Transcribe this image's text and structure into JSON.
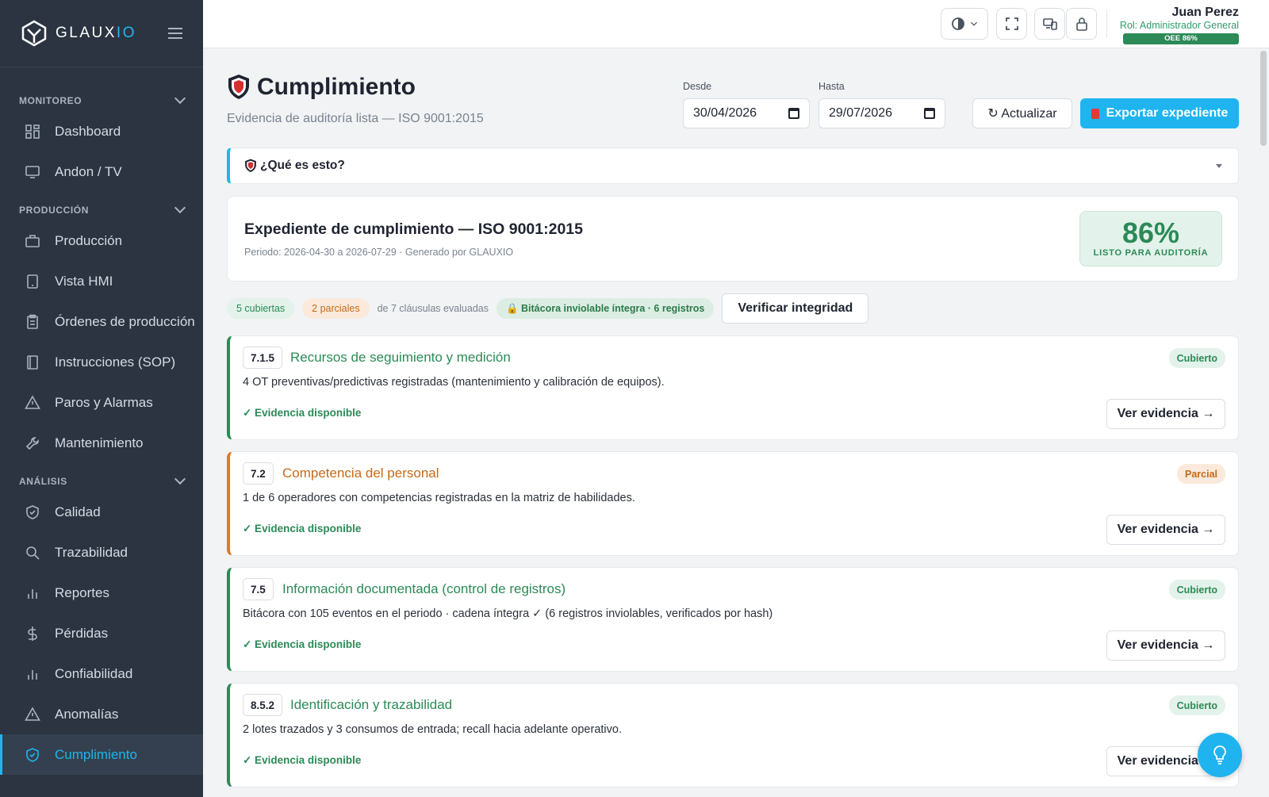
{
  "brand": {
    "name_a": "GLAUX",
    "name_b": "IO"
  },
  "sidebar": {
    "sections": [
      {
        "label": "MONITOREO",
        "items": [
          {
            "label": "Dashboard",
            "icon": "dashboard-icon"
          },
          {
            "label": "Andon / TV",
            "icon": "monitor-icon"
          }
        ]
      },
      {
        "label": "PRODUCCIÓN",
        "items": [
          {
            "label": "Producción",
            "icon": "briefcase-icon"
          },
          {
            "label": "Vista HMI",
            "icon": "tablet-icon"
          },
          {
            "label": "Órdenes de producción",
            "icon": "clipboard-icon"
          },
          {
            "label": "Instrucciones (SOP)",
            "icon": "book-icon"
          },
          {
            "label": "Paros y Alarmas",
            "icon": "warning-icon"
          },
          {
            "label": "Mantenimiento",
            "icon": "wrench-icon"
          }
        ]
      },
      {
        "label": "ANÁLISIS",
        "items": [
          {
            "label": "Calidad",
            "icon": "shield-check-icon"
          },
          {
            "label": "Trazabilidad",
            "icon": "search-icon"
          },
          {
            "label": "Reportes",
            "icon": "bar-chart-icon"
          },
          {
            "label": "Pérdidas",
            "icon": "dollar-icon"
          },
          {
            "label": "Confiabilidad",
            "icon": "bar-chart-icon"
          },
          {
            "label": "Anomalías",
            "icon": "warning-icon"
          },
          {
            "label": "Cumplimiento",
            "icon": "shield-check-icon",
            "active": true
          }
        ]
      }
    ]
  },
  "user": {
    "name": "Juan Perez",
    "role": "Rol: Administrador General",
    "oee": "OEE 86%"
  },
  "page": {
    "title": "Cumplimiento",
    "subtitle": "Evidencia de auditoría lista — ISO 9001:2015",
    "from_label": "Desde",
    "from_value": "30/04/2026",
    "to_label": "Hasta",
    "to_value": "29/07/2026",
    "refresh_label": "↻ Actualizar",
    "export_label": "Exportar expediente",
    "what_label": "¿Qué es esto?"
  },
  "expediente": {
    "title": "Expediente de cumplimiento — ISO 9001:2015",
    "meta": "Periodo: 2026-04-30 a 2026-07-29 · Generado por GLAUXIO",
    "score": "86%",
    "score_label": "LISTO PARA AUDITORÍA"
  },
  "summary": {
    "covered": "5 cubiertas",
    "partial": "2 parciales",
    "evaluated": "de 7 cláusulas evaluadas",
    "ledger": "🔒 Bitácora inviolable íntegra · 6 registros",
    "verify_label": "Verificar integridad"
  },
  "clauses": [
    {
      "num": "7.1.5",
      "title": "Recursos de seguimiento y medición",
      "status": "Cubierto",
      "desc": "4 OT preventivas/predictivas registradas (mantenimiento y calibración de equipos).",
      "evidence": "✓ Evidencia disponible",
      "button": "Ver evidencia →"
    },
    {
      "num": "7.2",
      "title": "Competencia del personal",
      "status": "Parcial",
      "desc": "1 de 6 operadores con competencias registradas en la matriz de habilidades.",
      "evidence": "✓ Evidencia disponible",
      "button": "Ver evidencia →"
    },
    {
      "num": "7.5",
      "title": "Información documentada (control de registros)",
      "status": "Cubierto",
      "desc": "Bitácora con 105 eventos en el periodo · cadena íntegra ✓ (6 registros inviolables, verificados por hash)",
      "evidence": "✓ Evidencia disponible",
      "button": "Ver evidencia →"
    },
    {
      "num": "8.5.2",
      "title": "Identificación y trazabilidad",
      "status": "Cubierto",
      "desc": "2 lotes trazados y 3 consumos de entrada; recall hacia adelante operativo.",
      "evidence": "✓ Evidencia disponible",
      "button": "Ver evidencia →"
    }
  ],
  "colors": {
    "accent": "#1fb4ef",
    "sidebar": "#2c3441",
    "green": "#2b8a57",
    "orange": "#e07a1f"
  }
}
